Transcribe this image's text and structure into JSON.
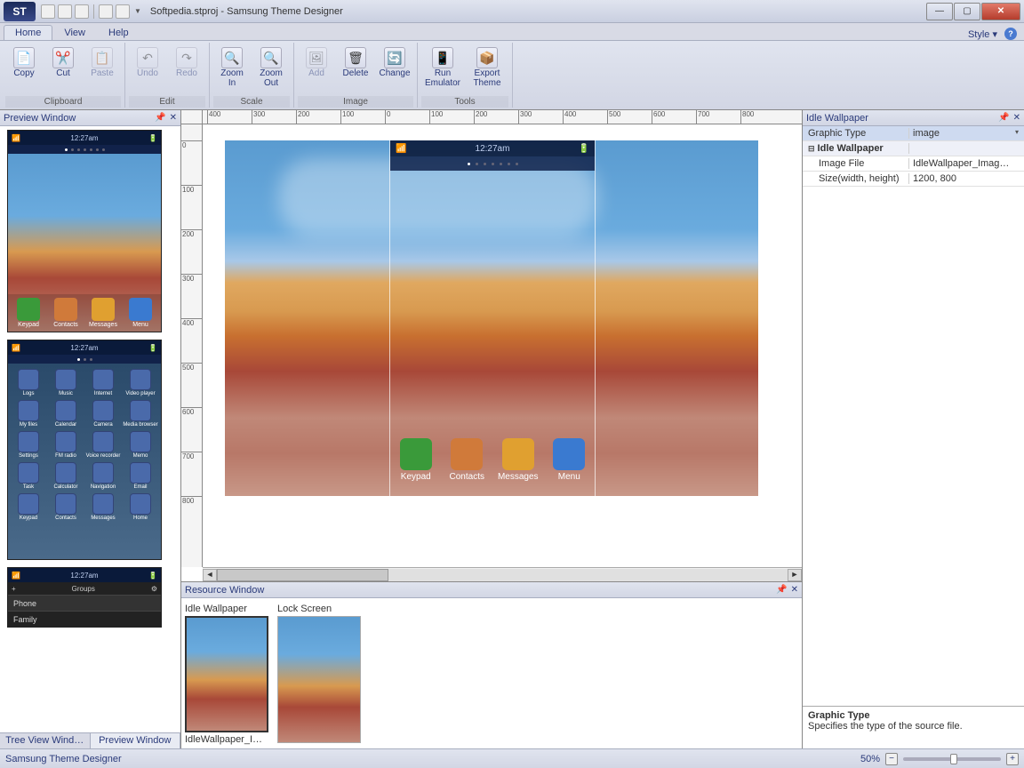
{
  "title": "Softpedia.stproj - Samsung Theme Designer",
  "app_logo": "ST",
  "menu": {
    "tabs": [
      "Home",
      "View",
      "Help"
    ],
    "active": 0,
    "style": "Style"
  },
  "ribbon": {
    "groups": [
      {
        "label": "Clipboard",
        "buttons": [
          {
            "label": "Copy",
            "icon": "📄"
          },
          {
            "label": "Cut",
            "icon": "✂️"
          },
          {
            "label": "Paste",
            "icon": "📋",
            "disabled": true
          }
        ]
      },
      {
        "label": "Edit",
        "buttons": [
          {
            "label": "Undo",
            "icon": "↶",
            "disabled": true
          },
          {
            "label": "Redo",
            "icon": "↷",
            "disabled": true
          }
        ]
      },
      {
        "label": "Scale",
        "buttons": [
          {
            "label": "Zoom In",
            "icon": "🔍"
          },
          {
            "label": "Zoom Out",
            "icon": "🔍"
          }
        ]
      },
      {
        "label": "Image",
        "buttons": [
          {
            "label": "Add",
            "icon": "🖼",
            "disabled": true
          },
          {
            "label": "Delete",
            "icon": "🗑"
          },
          {
            "label": "Change",
            "icon": "🔄"
          }
        ]
      },
      {
        "label": "Tools",
        "buttons": [
          {
            "label": "Run Emulator",
            "icon": "📱",
            "wide": true
          },
          {
            "label": "Export Theme",
            "icon": "📦",
            "wide": true
          }
        ]
      }
    ]
  },
  "preview": {
    "title": "Preview Window",
    "tabs": [
      "Tree View Wind…",
      "Preview Window"
    ],
    "active_tab": 1,
    "phone_time": "12:27am",
    "dock": [
      {
        "label": "Keypad",
        "color": "#3a9a3a"
      },
      {
        "label": "Contacts",
        "color": "#d07a3a"
      },
      {
        "label": "Messages",
        "color": "#e0a030"
      },
      {
        "label": "Menu",
        "color": "#3a7ad0"
      }
    ],
    "menu_apps": [
      "Logs",
      "Music",
      "Internet",
      "Video player",
      "My files",
      "Calendar",
      "Camera",
      "Media browser",
      "Settings",
      "FM radio",
      "Voice recorder",
      "Memo",
      "Task",
      "Calculator",
      "Navigation",
      "Email",
      "Keypad",
      "Contacts",
      "Messages",
      "Home"
    ],
    "groups_title": "Groups",
    "groups_sub": "Phone",
    "groups_item": "Family"
  },
  "canvas": {
    "ruler_top": [
      "400",
      "300",
      "200",
      "100",
      "0",
      "100",
      "200",
      "300",
      "400",
      "500",
      "600",
      "700",
      "800"
    ],
    "ruler_left": [
      "0",
      "100",
      "200",
      "300",
      "400",
      "500",
      "600",
      "700",
      "800"
    ],
    "phone_time": "12:27am",
    "dock": [
      {
        "label": "Keypad",
        "color": "#3a9a3a"
      },
      {
        "label": "Contacts",
        "color": "#d07a3a"
      },
      {
        "label": "Messages",
        "color": "#e0a030"
      },
      {
        "label": "Menu",
        "color": "#3a7ad0"
      }
    ]
  },
  "resource": {
    "title": "Resource Window",
    "items": [
      {
        "caption": "Idle Wallpaper",
        "filename": "IdleWallpaper_Image.png",
        "selected": true
      },
      {
        "caption": "Lock Screen",
        "filename": "",
        "selected": false
      }
    ]
  },
  "props": {
    "title": "Idle Wallpaper",
    "rows": [
      {
        "key": "Graphic Type",
        "val": "image",
        "dropdown": true,
        "selected": true
      },
      {
        "key": "Idle Wallpaper",
        "val": "",
        "category": true
      },
      {
        "key": "Image File",
        "val": "IdleWallpaper_Imag…",
        "indent": true
      },
      {
        "key": "Size(width, height)",
        "val": "1200, 800",
        "indent": true
      }
    ],
    "desc_title": "Graphic Type",
    "desc_text": "Specifies the type of the source file."
  },
  "status": {
    "text": "Samsung Theme Designer",
    "zoom": "50%"
  }
}
